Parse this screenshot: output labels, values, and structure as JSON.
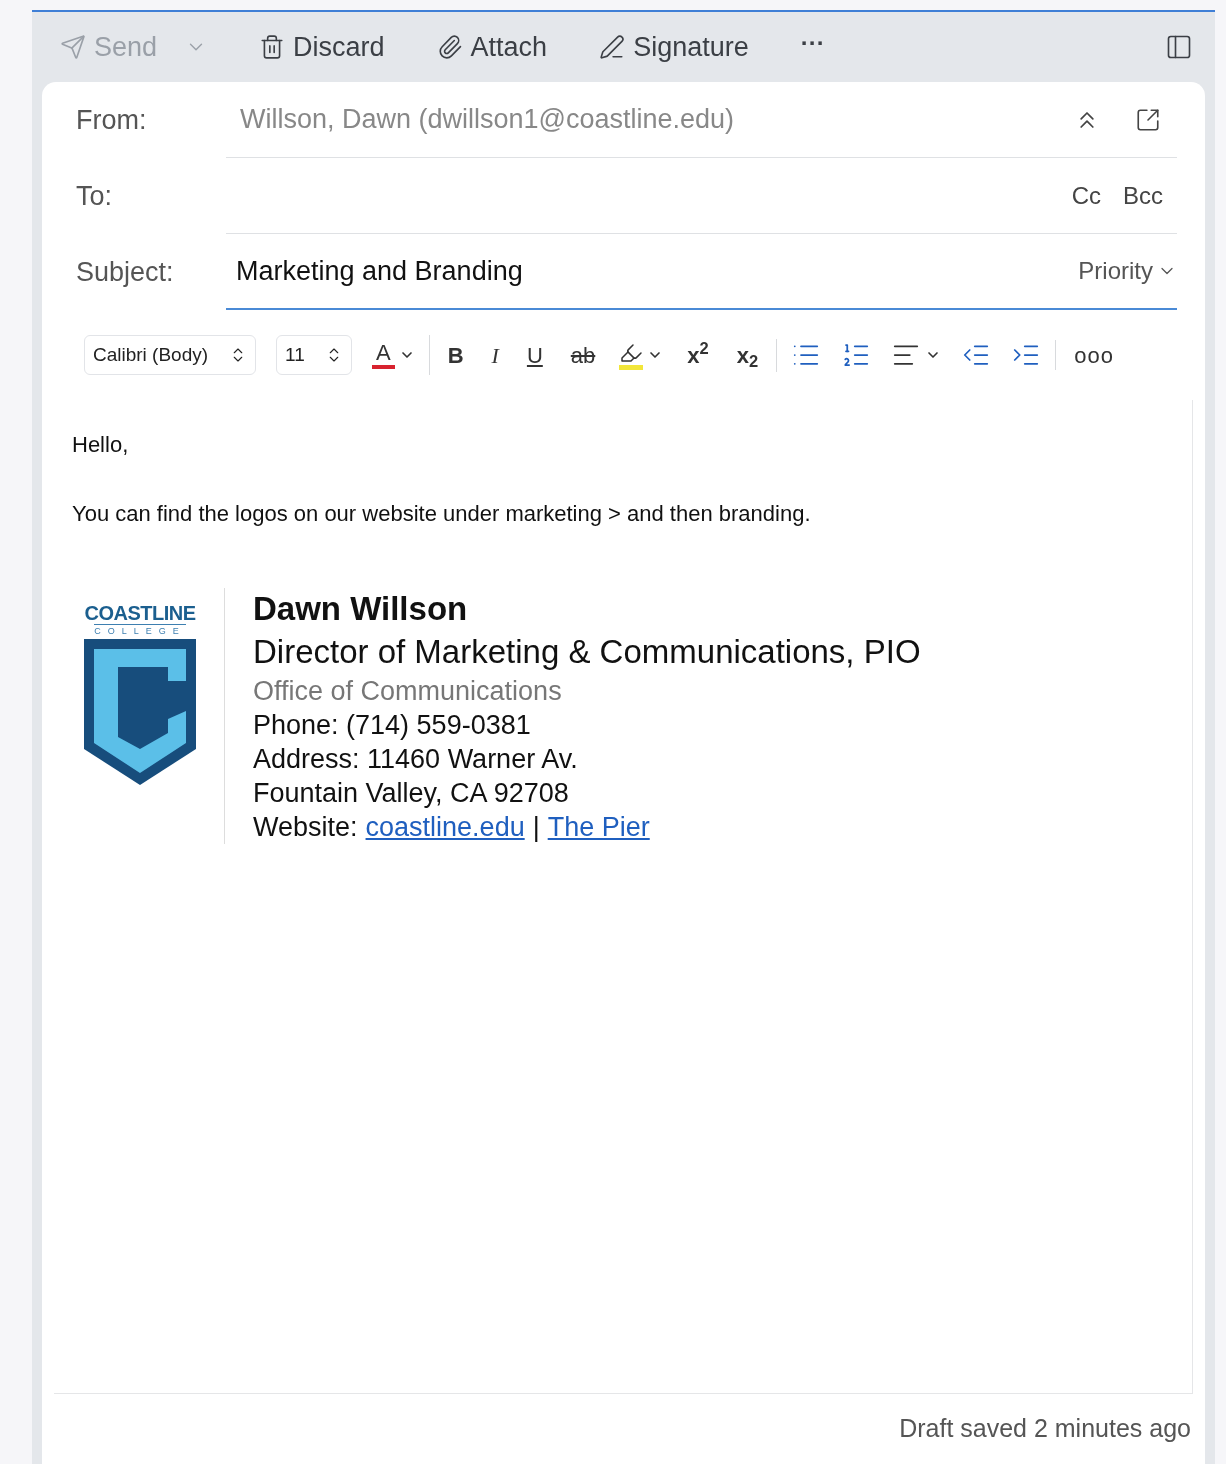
{
  "toolbar": {
    "actions": [
      {
        "kind": "send",
        "label": "Send",
        "disabled": true
      },
      {
        "kind": "discard",
        "label": "Discard",
        "disabled": false
      },
      {
        "kind": "attach",
        "label": "Attach",
        "disabled": false
      },
      {
        "kind": "signature",
        "label": "Signature",
        "disabled": false
      }
    ],
    "more": "···"
  },
  "header": {
    "from_label": "From:",
    "from_value": "Willson, Dawn (dwillson1@coastline.edu)",
    "to_label": "To:",
    "cc": "Cc",
    "bcc": "Bcc",
    "subject_label": "Subject:",
    "subject_value": "Marketing and Branding",
    "priority": "Priority"
  },
  "format_toolbar": {
    "groups": [
      [
        {
          "kind": "font",
          "value": "Calibri (Body)"
        },
        {
          "kind": "size",
          "value": "11"
        },
        {
          "kind": "font-color",
          "label": "A"
        }
      ],
      [
        {
          "kind": "bold",
          "label": "B"
        },
        {
          "kind": "italic",
          "label": "I"
        },
        {
          "kind": "underline",
          "label": "U"
        },
        {
          "kind": "strike",
          "label": "ab"
        },
        {
          "kind": "highlight"
        },
        {
          "kind": "superscript",
          "label": "x$^{2}$"
        },
        {
          "kind": "subscript",
          "label": "x$_{2}$"
        }
      ],
      [
        {
          "kind": "bullets"
        },
        {
          "kind": "numbering"
        },
        {
          "kind": "align"
        },
        {
          "kind": "outdent"
        },
        {
          "kind": "indent"
        }
      ],
      [
        {
          "kind": "more",
          "label": "ooo"
        }
      ]
    ]
  },
  "body": {
    "paragraphs": [
      "Hello,",
      "You can find the logos on our website under marketing > and then branding."
    ],
    "signature": {
      "logo_name": "COASTLINE",
      "logo_sub": "COLLEGE",
      "name": "Dawn Willson",
      "title": "Director of Marketing & Communications, PIO",
      "office": "Office of Communications",
      "lines": [
        "Phone: (714) 559-0381",
        "Address: 11460 Warner Av.",
        "Fountain Valley, CA 92708"
      ],
      "website_label": "Website:",
      "links": [
        "coastline.edu",
        "The Pier"
      ],
      "link_separator": "|"
    }
  },
  "status_bar": {
    "text": "Draft saved 2 minutes ago"
  }
}
